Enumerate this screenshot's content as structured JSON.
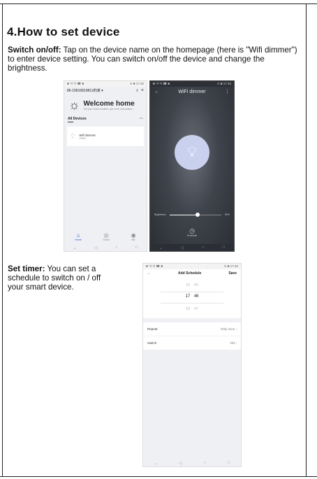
{
  "heading": "4.How to set device",
  "section1": {
    "label": "Switch on/off:",
    "text": " Tap on the device name on the homepage (here is \"Wifi dimmer\") to enter device setting. You can switch on/off the device and change the brightness."
  },
  "section2": {
    "label": "Set timer:",
    "text": " You can set a schedule to switch on / off your smart device."
  },
  "home_screen": {
    "status_left": "■ *ıl *ıl ☎ ■",
    "status_right": "⊙ ■ 17:45",
    "account": "86-15816819812的家 ▾",
    "welcome_title": "Welcome home",
    "welcome_sub": "Set your home location, get more information ›",
    "all_devices": "All Devices",
    "more": "···",
    "device_name": "Wifi dimmer",
    "device_status": "Offline",
    "tabs": [
      "Home",
      "Smart",
      "Me"
    ]
  },
  "dimmer_screen": {
    "status_left": "■ *ıl *ıl ☎ ■",
    "status_right": "⊙ ■ 17:45",
    "title": "WiFi dimmer",
    "brightness_label": "Brightness",
    "brightness_value": "50%",
    "brightness_level": 0.55,
    "schedule_label": "Schedule"
  },
  "schedule_screen": {
    "status_left": "■ *ıl *ıl ☎ ■",
    "status_right": "⊙ ■ 17:45",
    "title": "Add Schedule",
    "save": "Save",
    "time_above": "16   45",
    "time_selected": "17   46",
    "time_below": "18   47",
    "repeat_label": "Repeat",
    "repeat_value": "Only once  ›",
    "switch_label": "Switch",
    "switch_value": "ON  ›"
  },
  "nav_icons": [
    "back-icon",
    "circle-home-icon",
    "square-recent-icon"
  ],
  "colors": {
    "accent": "#1a56d6",
    "bulb_circle": "#c9d1ee"
  }
}
